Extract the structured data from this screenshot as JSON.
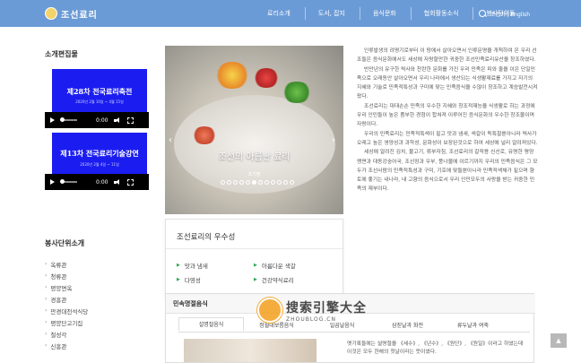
{
  "header": {
    "logo_text": "조선료리",
    "nav": [
      "료리소개",
      "도서, 잡지",
      "음식문화",
      "협회활동소식",
      "봉사단위들"
    ],
    "language": "조선어 | English"
  },
  "sidebar": {
    "videos_title": "소개편집물",
    "videos": [
      {
        "title": "제28차 전국료리축전",
        "date": "2020년 2월 10일 ~ 4월 15일",
        "time": "0:00"
      },
      {
        "title": "제13차 전국료리기술강연",
        "date": "2020년 2월 4일 ~ 11일",
        "time": "0:00"
      }
    ],
    "units_title": "봉사단위소개",
    "units": [
      "옥류관",
      "청류관",
      "평양면옥",
      "경흥관",
      "만경대천석식당",
      "평양단고기집",
      "철성각",
      "신흥관"
    ]
  },
  "slider": {
    "caption": "조선의 아름난 료리",
    "subcaption": "조기찜",
    "dots": 12,
    "active_dot": 5
  },
  "excellence": {
    "title": "조선료리의 우수성",
    "items": [
      "맛과 냄새",
      "아름다운 색갈",
      "다영성",
      "건강약식료리"
    ]
  },
  "article": {
    "paragraphs": [
      "인류발생의 려명기로부터 이 땅에서 살아오면서 인류문명을 개척하여 온 우리 선조들은 음식문화에서도 세상에 자랑할만한 귀중한 조선민족료리유산을 창조하였다.",
      "반만년의 유구한 력사와 찬란한 문화를 가진 우리 민족은 피와 줄을 이은 단일민족으로 오래동안 살아오면서 우리 나라에서 생산되는 식생활재료를 가지고 자기의 지혜와 기술로 민족적특성과 구미에 맞는 민족음식을 수많이 창조하고 계승발전시켜왔다.",
      "조선료리는 대대손손 민족의 우수한 지혜와 창조적재능을 식생활로 하는 과정에 우리 인민들이 높은 품부한 경험이 합쳐져 이루어진 음식문화의 우수한 창조물이며 자랑이다.",
      "우리의 민족료리는 민족적특색이 짙고 맛과 냄새, 색갈이 독특할뿐아니라 력사가 오래고 높은 영양성과 과학성, 문화성이 보장된것으로 하여 세상에 널리 알려져있다.",
      "세상에 알려진 김치, 불고기, 류부자침, 조선료리의 갈작용 신선로, 유명한 평양랭면과 대동강숭어국, 조선장과 우부, 풍나물에 이르기까지 우리의 민족음식은 그 모두가 조선사람의 민족적특성과 구미, 기호에 맞들뿐아니라 민족적색채가 짙으며 향토에 좋기는 내나라, 내 고향의 음식으로서 우리 인민모두의 사랑을 받는 귀중한 민족의 재부이다."
    ]
  },
  "popular": {
    "title": "민속명절음식",
    "tabs": [
      "설명절음식",
      "정월대보름음식",
      "일곱날음식",
      "삼짇날과 화전",
      "류두날과 여죽"
    ],
    "active_tab": 0,
    "text": "옛기록들에는 설명절을 《세수》, 《년수》, 《원단》, 《원일》이라고 하였는데 이것은 모두 한해의 첫날이라는 뜻이였다."
  },
  "watermark": {
    "main": "搜索引擎大全",
    "sub": "ZHOUBLOG.CN"
  },
  "scroll_top_icon": "chevron-up-icon"
}
